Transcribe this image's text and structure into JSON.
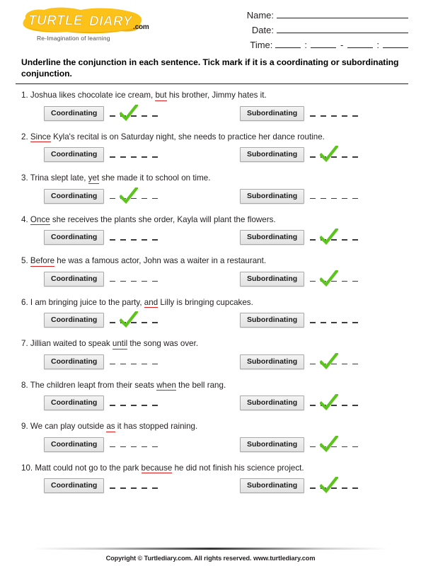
{
  "brand": {
    "logo_text": "TURTLE DIARY",
    "logo_word_1": "TURTLE",
    "logo_word_2": "DIARY",
    "dotcom": ".com",
    "tagline": "Re-Imagination of learning",
    "logo_color": "#fdc219",
    "logo_shadow_color": "#e8a000"
  },
  "header": {
    "name_label": "Name:",
    "date_label": "Date:",
    "time_label": "Time:",
    "time_colon": ":",
    "time_dash": "-"
  },
  "instructions": "Underline the conjunction in each sentence. Tick mark if it is a coordinating or subordinating conjunction.",
  "options": {
    "coordinating_label": "Coordinating",
    "subordinating_label": "Subordinating"
  },
  "colors": {
    "tick_green": "#5cc41c",
    "underline_red": "#e01b1b",
    "button_face": "#e9e9e9",
    "text": "#231f20"
  },
  "questions": [
    {
      "number": "1.",
      "before": "Joshua likes chocolate ice cream, ",
      "conjunction": "but",
      "after": " his brother, Jimmy hates it.",
      "answer": "coordinating"
    },
    {
      "number": "2.",
      "before": "",
      "conjunction": "Since",
      "after": " Kyla's recital is on Saturday night, she needs to practice her dance routine.",
      "answer": "subordinating"
    },
    {
      "number": "3.",
      "before": "Trina slept late, ",
      "conjunction": "yet",
      "after": " she made it to school on time.",
      "answer": "coordinating"
    },
    {
      "number": "4.",
      "before": "",
      "conjunction": "Once",
      "after": " she receives the plants she order, Kayla will plant the flowers.",
      "answer": "subordinating"
    },
    {
      "number": "5.",
      "before": "",
      "conjunction": "Before",
      "after": " he was a famous actor, John was a waiter in a restaurant.",
      "answer": "subordinating"
    },
    {
      "number": "6.",
      "before": "I am bringing juice to the party, ",
      "conjunction": "and",
      "after": " Lilly is bringing cupcakes.",
      "answer": "coordinating"
    },
    {
      "number": "7.",
      "before": "Jillian waited to speak ",
      "conjunction": "until",
      "after": " the song was over.",
      "answer": "subordinating"
    },
    {
      "number": "8.",
      "before": "The children leapt from their seats ",
      "conjunction": "when",
      "after": " the bell rang.",
      "answer": "subordinating"
    },
    {
      "number": "9.",
      "before": "We can play outside ",
      "conjunction": "as",
      "after": " it has stopped raining.",
      "answer": "subordinating"
    },
    {
      "number": "10.",
      "before": "Matt could not go to the park ",
      "conjunction": "because",
      "after": " he did not finish his science project.",
      "answer": "subordinating"
    }
  ],
  "footer": {
    "copyright": "Copyright © Turtlediary.com. All rights reserved. www.turtlediary.com"
  }
}
